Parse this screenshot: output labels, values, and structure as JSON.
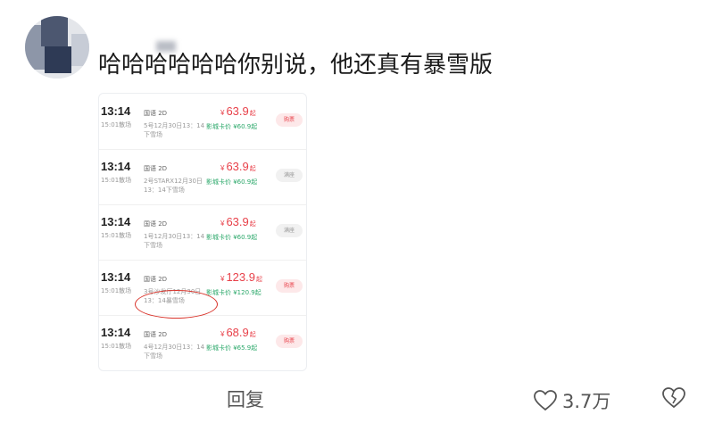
{
  "comment": {
    "text": "哈哈哈哈哈哈你别说，他还真有暴雪版"
  },
  "screenshot": {
    "rows": [
      {
        "time": "13:14",
        "end": "15:01散场",
        "lang": "国语 2D",
        "hall": "5号12月30日13：14下雪场",
        "price": "63.9",
        "card": "影城卡价 ¥60.9起",
        "button": "购票",
        "btn_type": "buy"
      },
      {
        "time": "13:14",
        "end": "15:01散场",
        "lang": "国语 2D",
        "hall": "2号STARX12月30日13：14下雪场",
        "price": "63.9",
        "card": "影城卡价 ¥60.9起",
        "button": "满座",
        "btn_type": "full"
      },
      {
        "time": "13:14",
        "end": "15:01散场",
        "lang": "国语 2D",
        "hall": "1号12月30日13：14下雪场",
        "price": "63.9",
        "card": "影城卡价 ¥60.9起",
        "button": "满座",
        "btn_type": "full"
      },
      {
        "time": "13:14",
        "end": "15:01散场",
        "lang": "国语 2D",
        "hall": "3号沙发厅12月30日13：14暴雪场",
        "price": "123.9",
        "card": "影城卡价 ¥120.9起",
        "button": "购票",
        "btn_type": "buy"
      },
      {
        "time": "13:14",
        "end": "15:01散场",
        "lang": "国语 2D",
        "hall": "4号12月30日13：14下雪场",
        "price": "68.9",
        "card": "影城卡价 ¥65.9起",
        "button": "购票",
        "btn_type": "buy"
      }
    ],
    "currency": "¥",
    "price_suffix": "起"
  },
  "actions": {
    "reply": "回复",
    "like_count": "3.7万"
  },
  "colors": {
    "price": "#e8414a",
    "card_price": "#2ba86a",
    "highlight_circle": "#d9342b"
  },
  "icons": {
    "like": "heart-outline-icon",
    "dislike": "broken-heart-icon"
  }
}
